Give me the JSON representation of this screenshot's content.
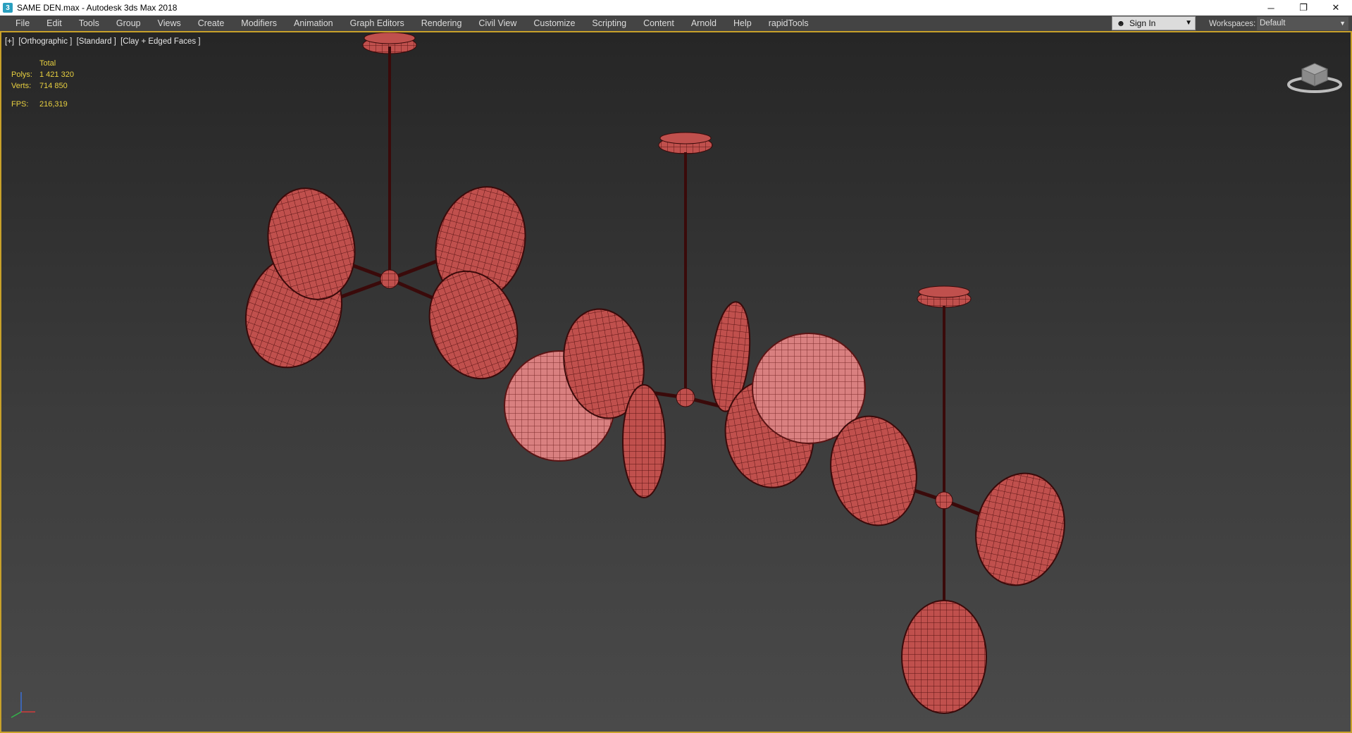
{
  "window": {
    "title": "SAME DEN.max - Autodesk 3ds Max 2018",
    "app_icon_glyph": "3",
    "controls": {
      "minimize": "─",
      "restore": "❐",
      "close": "✕"
    }
  },
  "menu": {
    "items": [
      "File",
      "Edit",
      "Tools",
      "Group",
      "Views",
      "Create",
      "Modifiers",
      "Animation",
      "Graph Editors",
      "Rendering",
      "Civil View",
      "Customize",
      "Scripting",
      "Content",
      "Arnold",
      "Help",
      "rapidTools"
    ],
    "sign_in": "Sign In",
    "workspaces_label": "Workspaces:",
    "workspace_value": "Default"
  },
  "viewport": {
    "label_parts": [
      "[+]",
      "[Orthographic ]",
      "[Standard ]",
      "[Clay + Edged Faces ]"
    ],
    "stats": {
      "header": "Total",
      "polys_label": "Polys:",
      "polys_value": "1 421 320",
      "verts_label": "Verts:",
      "verts_value": "714 850",
      "fps_label": "FPS:",
      "fps_value": "216,319"
    }
  },
  "colors": {
    "accent_border": "#c8a12a",
    "stats_text": "#e8d040",
    "clay_red": "#c0504d",
    "clay_dark": "#5a1414",
    "clay_highlight": "#d98080"
  },
  "icons": {
    "user": "user-icon",
    "viewcube": "viewcube-icon",
    "axis": "axis-tripod-icon"
  }
}
